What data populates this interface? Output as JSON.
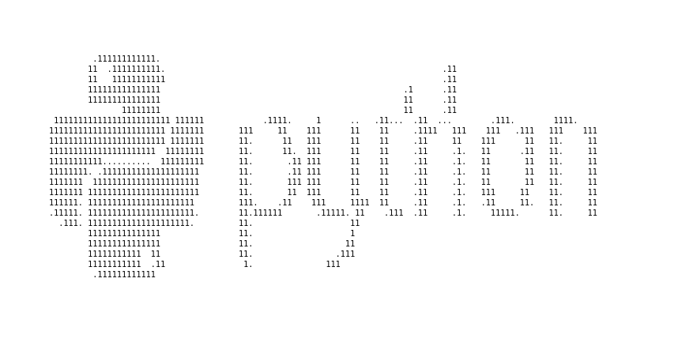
{
  "logo_art": "         .111111111111.\n        11  .1111111111.\n        11   11111111111\n        111111111111111\n        111111111111111\n               11111111\n 111111111111111111111111 111111\n111111111111111111111111 1111111\n111111111111111111111111 1111111\n1111111111111111111111  11111111\n11111111111..........  111111111\n11111111. .11111111111111111111\n1111111  1111111111111111111111\n1111111 11111111111111111111111\n111111. 1111111111111111111111\n.11111. 1111111111111111111111.\n  .111. 111111111111111111111.\n        111111111111111\n        111111111111111\n        11111111111  11\n        11111111111  .11\n         .111111111111",
  "word_art": "                                          .11\n                                          .11\n                                  .1      .11\n                                  11      .11\n                                  11      .11\n     .1111.     1      ..   .11...  .11  ...        .111.        1111.\n111     11    111      11    11     .1111   111    111   .111   111    111\n11.      11   111      11    11     .11     11    111      11   11.     11\n11.      11.  111      11    11     .11     .1.   11      .11   11.     11\n11.       .11 111      11    11     .11     .1.   11       11   11.     11\n11.       .11 111      11    11     .11     .1.   11       11   11.     11\n11.       111 111      11    11     .11     .1.   11       11   11.     11\n11.       11  111      11    11     .11     .1.   111     11    11.     11\n111.    .11    111     1111  11     .11     .1.   .11     11.   11.     11\n11.111111       .11111. 11    .111  .11     .1.     11111.      11.     11\n11.                    11\n11.                    1\n11.                   11\n11.                 .111\n 1.               111"
}
